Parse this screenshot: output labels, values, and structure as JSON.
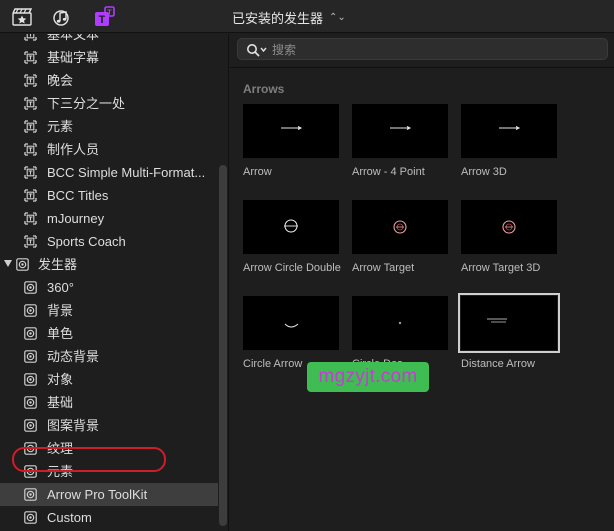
{
  "toolbar": {
    "buttons": [
      {
        "name": "clapper-star-icon"
      },
      {
        "name": "music-note-icon"
      },
      {
        "name": "title-generator-icon",
        "active": true
      }
    ],
    "library_title": "已安装的发生器",
    "library_chevron": "⌃⌄"
  },
  "sidebar": {
    "items": [
      {
        "label": "基本文本",
        "icon": "title-icon",
        "clipped": true
      },
      {
        "label": "基础字幕",
        "icon": "title-icon"
      },
      {
        "label": "晚会",
        "icon": "title-icon"
      },
      {
        "label": "下三分之一处",
        "icon": "title-icon"
      },
      {
        "label": "元素",
        "icon": "title-icon"
      },
      {
        "label": "制作人员",
        "icon": "title-icon"
      },
      {
        "label": "BCC Simple Multi-Format...",
        "icon": "title-icon"
      },
      {
        "label": "BCC Titles",
        "icon": "title-icon"
      },
      {
        "label": "mJourney",
        "icon": "title-icon"
      },
      {
        "label": "Sports Coach",
        "icon": "title-icon"
      },
      {
        "label": "发生器",
        "icon": "generator-icon",
        "group": true,
        "expanded": true
      },
      {
        "label": "360°",
        "icon": "generator-icon"
      },
      {
        "label": "背景",
        "icon": "generator-icon"
      },
      {
        "label": "单色",
        "icon": "generator-icon"
      },
      {
        "label": "动态背景",
        "icon": "generator-icon"
      },
      {
        "label": "对象",
        "icon": "generator-icon"
      },
      {
        "label": "基础",
        "icon": "generator-icon"
      },
      {
        "label": "图案背景",
        "icon": "generator-icon"
      },
      {
        "label": "纹理",
        "icon": "generator-icon"
      },
      {
        "label": "元素",
        "icon": "generator-icon"
      },
      {
        "label": "Arrow Pro ToolKit",
        "icon": "generator-icon",
        "selected": true
      },
      {
        "label": "Custom",
        "icon": "generator-icon"
      }
    ]
  },
  "main": {
    "search": {
      "value": "",
      "placeholder": "搜索"
    },
    "section_title": "Arrows",
    "tiles": [
      {
        "label": "Arrow",
        "thumb": "arrow"
      },
      {
        "label": "Arrow - 4 Point",
        "thumb": "arrow"
      },
      {
        "label": "Arrow 3D",
        "thumb": "arrow"
      },
      {
        "label": "Arrow Circle Double",
        "thumb": "circle-white"
      },
      {
        "label": "Arrow Target",
        "thumb": "circle-red"
      },
      {
        "label": "Arrow Target 3D",
        "thumb": "circle-red"
      },
      {
        "label": "Circle Arrow",
        "thumb": "arc"
      },
      {
        "label": "Circle Dos",
        "thumb": "dot"
      },
      {
        "label": "Distance Arrow",
        "thumb": "distance",
        "selected": true
      }
    ]
  },
  "watermark": {
    "text": "mgzyjt.com"
  },
  "colors": {
    "selection_ring": "#d01e26",
    "watermark_bg": "#3fbd53",
    "watermark_text": "#c83ad6",
    "active_tool": "#b03cff"
  }
}
